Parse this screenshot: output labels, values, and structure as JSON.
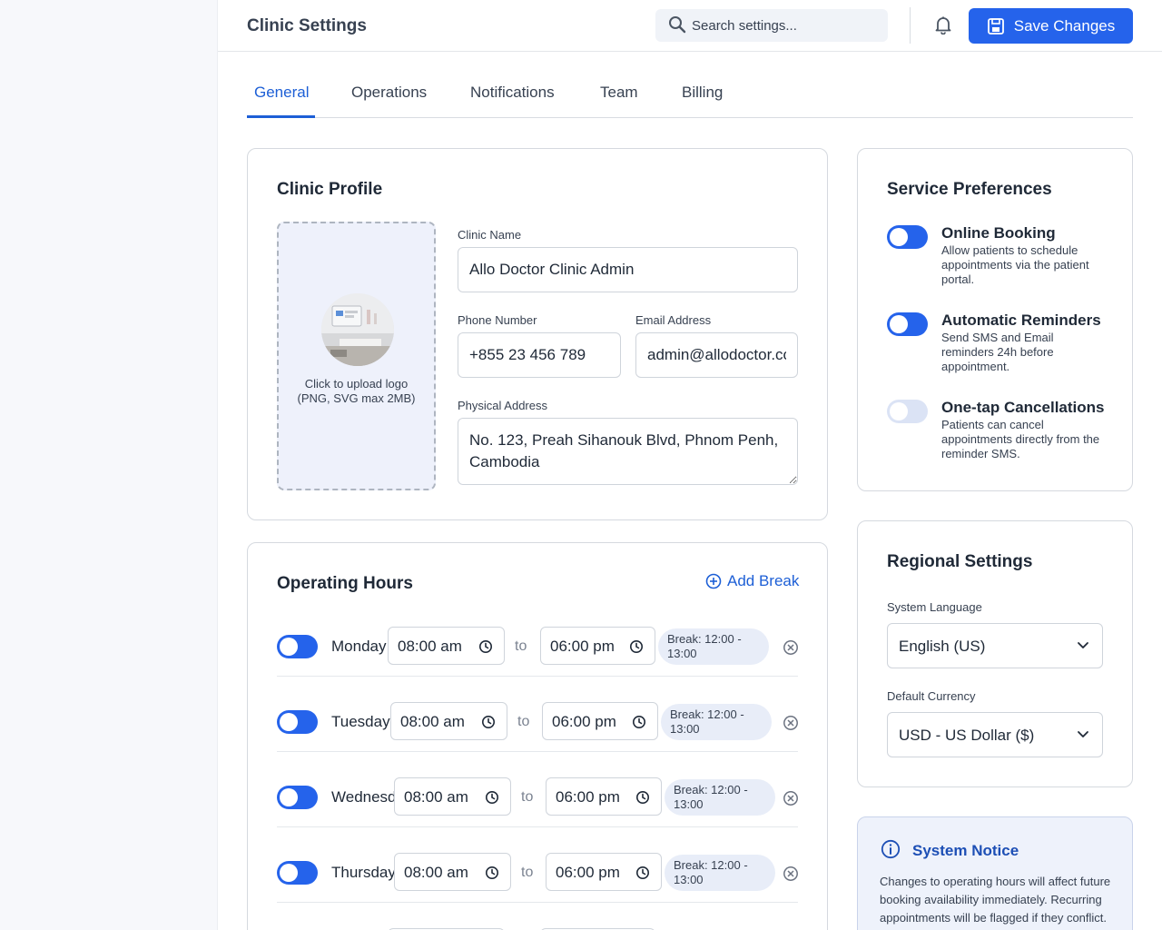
{
  "header": {
    "title": "Clinic Settings",
    "search_placeholder": "Search settings...",
    "save_label": "Save Changes"
  },
  "tabs": [
    {
      "label": "General",
      "active": true
    },
    {
      "label": "Operations"
    },
    {
      "label": "Notifications"
    },
    {
      "label": "Team"
    },
    {
      "label": "Billing"
    }
  ],
  "profile": {
    "title": "Clinic Profile",
    "upload_text": "Click to upload logo (PNG, SVG max 2MB)",
    "clinic_name_label": "Clinic Name",
    "clinic_name": "Allo Doctor Clinic Admin",
    "phone_label": "Phone Number",
    "phone": "+855 23 456 789",
    "email_label": "Email Address",
    "email": "admin@allodoctor.com",
    "address_label": "Physical Address",
    "address": "No. 123, Preah Sihanouk Blvd, Phnom Penh, Cambodia"
  },
  "hours": {
    "title": "Operating Hours",
    "add_break_label": "Add Break",
    "to_label": "to",
    "days": [
      {
        "day": "Monday",
        "open": "08:00 am",
        "close": "06:00 pm",
        "break": "Break: 12:00 - 13:00",
        "enabled": true
      },
      {
        "day": "Tuesday",
        "open": "08:00 am",
        "close": "06:00 pm",
        "break": "Break: 12:00 - 13:00",
        "enabled": true
      },
      {
        "day": "Wednesday",
        "open": "08:00 am",
        "close": "06:00 pm",
        "break": "Break: 12:00 - 13:00",
        "enabled": true
      },
      {
        "day": "Thursday",
        "open": "08:00 am",
        "close": "06:00 pm",
        "break": "Break: 12:00 - 13:00",
        "enabled": true
      }
    ]
  },
  "service": {
    "title": "Service Preferences",
    "items": [
      {
        "title": "Online Booking",
        "desc": "Allow patients to schedule appointments via the patient portal.",
        "enabled": true
      },
      {
        "title": "Automatic Reminders",
        "desc": "Send SMS and Email reminders 24h before appointment.",
        "enabled": true
      },
      {
        "title": "One-tap Cancellations",
        "desc": "Patients can cancel appointments directly from the reminder SMS.",
        "enabled": false
      }
    ]
  },
  "regional": {
    "title": "Regional Settings",
    "language_label": "System Language",
    "language": "English (US)",
    "currency_label": "Default Currency",
    "currency": "USD - US Dollar ($)"
  },
  "notice": {
    "title": "System Notice",
    "text": "Changes to operating hours will affect future booking availability immediately. Recurring appointments will be flagged if they conflict."
  },
  "colors": {
    "primary": "#2563eb",
    "toggle_off": "#dbe3f5",
    "notice_bg": "#eef2fb"
  }
}
